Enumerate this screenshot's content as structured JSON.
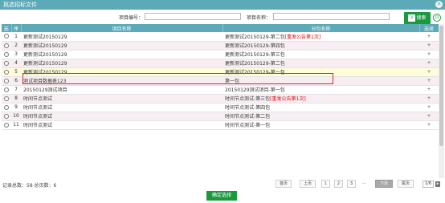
{
  "window": {
    "title": "挑选招标文件",
    "close_glyph": "✕"
  },
  "search": {
    "project_no_label": "项目编号：",
    "project_no_value": "",
    "project_name_label": "项目名称：",
    "project_name_value": "",
    "search_button_label": "搜索",
    "search_icon_glyph": "⌕",
    "circle_icon_glyph": "⊙"
  },
  "table": {
    "columns": [
      "选",
      "序",
      "项目名称",
      "分包名称",
      "选择"
    ],
    "rows": [
      {
        "no": "1",
        "name": "更新测试20150129",
        "pack": "更新测试20150129-第二包",
        "note": "[重发公告第1次]"
      },
      {
        "no": "2",
        "name": "更新测试20150129",
        "pack": "更新测试20150129-第四包",
        "note": ""
      },
      {
        "no": "3",
        "name": "更新测试20150129",
        "pack": "更新测试20150129-第三包",
        "note": ""
      },
      {
        "no": "4",
        "name": "更新测试20150129",
        "pack": "更新测试20150129-第二包",
        "note": ""
      },
      {
        "no": "5",
        "name": "更新测试20150129",
        "pack": "更新测试20150129-第一包",
        "note": ""
      },
      {
        "no": "6",
        "name": "测试项目数据表123",
        "pack": "第一包",
        "note": ""
      },
      {
        "no": "7",
        "name": "20150129测试项目",
        "pack": "20150129测试项目-第一包",
        "note": ""
      },
      {
        "no": "8",
        "name": "时间节点测试",
        "pack": "时间节点测试-第三包",
        "note": "[重发公告第1次]"
      },
      {
        "no": "9",
        "name": "时间节点测试",
        "pack": "时间节点测试-第四包",
        "note": ""
      },
      {
        "no": "10",
        "name": "时间节点测试",
        "pack": "时间节点测试-第二包",
        "note": ""
      },
      {
        "no": "11",
        "name": "时间节点测试",
        "pack": "时间节点测试-第一包",
        "note": ""
      }
    ],
    "select_glyph": "+"
  },
  "footer": {
    "stats": "记录总数：58  总页数：6",
    "first": "首页",
    "prev": "上页",
    "pages": [
      "1",
      "2",
      "3"
    ],
    "dots": "...",
    "next": "下页",
    "last": "尾页",
    "page_input": "1/6",
    "go_glyph": "▸",
    "confirm_label": "确定选择"
  },
  "colors": {
    "header": "#5ca9b8",
    "accent_green": "#1a9a3f",
    "highlight_red": "#d42a2a"
  }
}
